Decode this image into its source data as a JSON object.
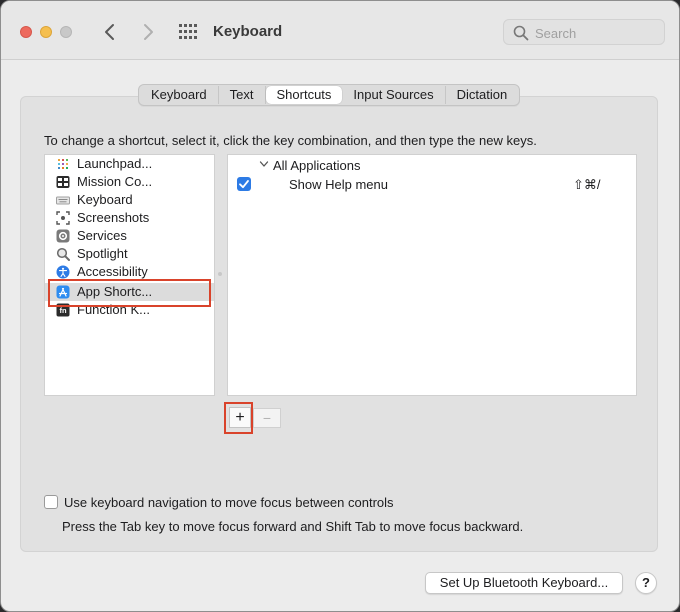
{
  "window": {
    "title": "Keyboard"
  },
  "titlebar": {
    "search_placeholder": "Search"
  },
  "tabs": [
    {
      "label": "Keyboard",
      "active": false
    },
    {
      "label": "Text",
      "active": false
    },
    {
      "label": "Shortcuts",
      "active": true
    },
    {
      "label": "Input Sources",
      "active": false
    },
    {
      "label": "Dictation",
      "active": false
    }
  ],
  "instructions": "To change a shortcut, select it, click the key combination, and then type the new keys.",
  "categories": [
    {
      "label": "Launchpad...",
      "icon": "launchpad-icon"
    },
    {
      "label": "Mission Co...",
      "icon": "mission-control-icon"
    },
    {
      "label": "Keyboard",
      "icon": "keyboard-icon"
    },
    {
      "label": "Screenshots",
      "icon": "screenshots-icon"
    },
    {
      "label": "Services",
      "icon": "gear-icon"
    },
    {
      "label": "Spotlight",
      "icon": "magnifier-icon"
    },
    {
      "label": "Accessibility",
      "icon": "accessibility-icon"
    },
    {
      "label": "App Shortc...",
      "icon": "app-store-icon",
      "selected": true
    },
    {
      "label": "Function K...",
      "icon": "fn-key-icon"
    }
  ],
  "shortcuts": {
    "group_label": "All Applications",
    "rows": [
      {
        "label": "Show Help menu",
        "keys": "⇧⌘/",
        "enabled": true
      }
    ]
  },
  "buttons": {
    "add": "+",
    "remove": "−"
  },
  "keyboard_navigation": {
    "label": "Use keyboard navigation to move focus between controls",
    "checked": false,
    "help": "Press the Tab key to move focus forward and Shift Tab to move focus backward."
  },
  "footer": {
    "bluetooth_button": "Set Up Bluetooth Keyboard...",
    "help_button": "?"
  }
}
